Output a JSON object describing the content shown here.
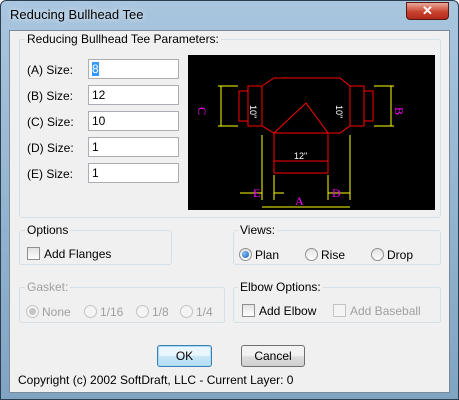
{
  "window": {
    "title": "Reducing Bullhead Tee",
    "close_glyph": "✕"
  },
  "params": {
    "legend": "Reducing Bullhead Tee Parameters:",
    "fields": [
      {
        "label": "(A) Size:",
        "value": "8"
      },
      {
        "label": "(B) Size:",
        "value": "12"
      },
      {
        "label": "(C) Size:",
        "value": "10"
      },
      {
        "label": "(D) Size:",
        "value": "1"
      },
      {
        "label": "(E) Size:",
        "value": "1"
      }
    ]
  },
  "diagram": {
    "left_dim": "10\"",
    "right_dim": "10\"",
    "center_dim": "12\"",
    "letters": {
      "a": "A",
      "b": "B",
      "c": "C",
      "d": "D",
      "e": "E"
    },
    "colors": {
      "pipe": "#ff0000",
      "dims": "#ffff00",
      "letters": "#ff00ff",
      "text": "#ffffff",
      "background": "#000000"
    }
  },
  "options": {
    "legend": "Options",
    "add_flanges_label": "Add Flanges",
    "add_flanges_checked": false
  },
  "views": {
    "legend": "Views:",
    "items": [
      {
        "label": "Plan",
        "selected": true
      },
      {
        "label": "Rise",
        "selected": false
      },
      {
        "label": "Drop",
        "selected": false
      }
    ]
  },
  "gasket": {
    "legend": "Gasket:",
    "enabled": false,
    "items": [
      {
        "label": "None",
        "selected": true
      },
      {
        "label": "1/16",
        "selected": false
      },
      {
        "label": "1/8",
        "selected": false
      },
      {
        "label": "1/4",
        "selected": false
      }
    ]
  },
  "elbow": {
    "legend": "Elbow Options:",
    "add_elbow_label": "Add Elbow",
    "add_elbow_checked": false,
    "add_baseball_label": "Add Baseball",
    "add_baseball_enabled": false
  },
  "buttons": {
    "ok": "OK",
    "cancel": "Cancel"
  },
  "status": {
    "copyright": "Copyright (c) 2002 SoftDraft, LLC - Current Layer: 0"
  }
}
